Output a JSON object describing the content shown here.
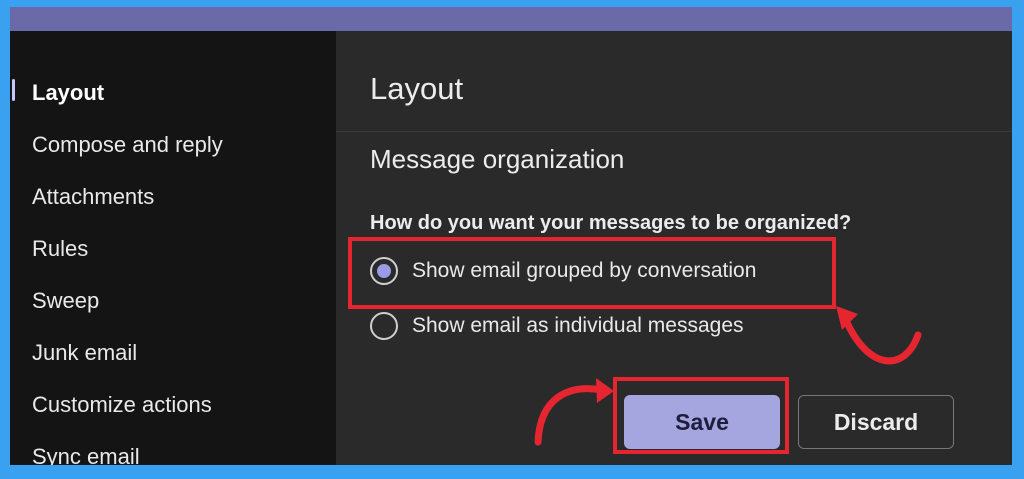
{
  "sidebar": {
    "items": [
      {
        "label": "Layout",
        "active": true
      },
      {
        "label": "Compose and reply"
      },
      {
        "label": "Attachments"
      },
      {
        "label": "Rules"
      },
      {
        "label": "Sweep"
      },
      {
        "label": "Junk email"
      },
      {
        "label": "Customize actions"
      },
      {
        "label": "Sync email"
      }
    ]
  },
  "main": {
    "title": "Layout",
    "section": "Message organization",
    "question": "How do you want your messages to be organized?",
    "options": [
      {
        "label": "Show email grouped by conversation",
        "selected": true
      },
      {
        "label": "Show email as individual messages",
        "selected": false
      }
    ],
    "save_label": "Save",
    "discard_label": "Discard"
  },
  "colors": {
    "accent": "#a5a5e0",
    "highlight": "#e52631",
    "topbar": "#6a6aa8",
    "background": "#3aa0f0"
  },
  "icons": {
    "annotation_arrows": "curved-arrow-icon"
  }
}
